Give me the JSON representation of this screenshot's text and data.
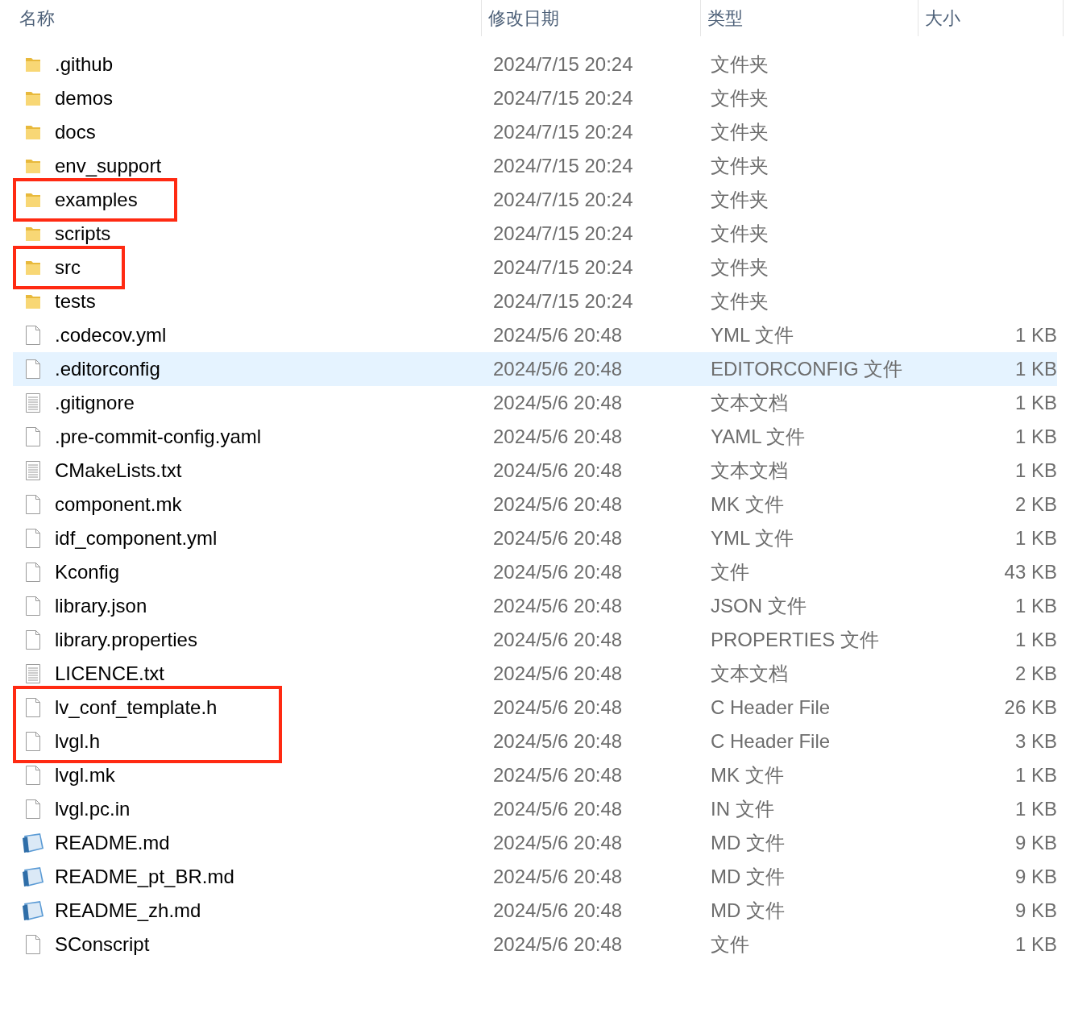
{
  "columns": [
    "名称",
    "修改日期",
    "类型",
    "大小"
  ],
  "rows": [
    {
      "kind": "folder",
      "name": ".github",
      "date": "2024/7/15 20:24",
      "type": "文件夹",
      "size": "",
      "selected": false,
      "annotated": false
    },
    {
      "kind": "folder",
      "name": "demos",
      "date": "2024/7/15 20:24",
      "type": "文件夹",
      "size": "",
      "selected": false,
      "annotated": false
    },
    {
      "kind": "folder",
      "name": "docs",
      "date": "2024/7/15 20:24",
      "type": "文件夹",
      "size": "",
      "selected": false,
      "annotated": false
    },
    {
      "kind": "folder",
      "name": "env_support",
      "date": "2024/7/15 20:24",
      "type": "文件夹",
      "size": "",
      "selected": false,
      "annotated": false
    },
    {
      "kind": "folder",
      "name": "examples",
      "date": "2024/7/15 20:24",
      "type": "文件夹",
      "size": "",
      "selected": false,
      "annotated": true
    },
    {
      "kind": "folder",
      "name": "scripts",
      "date": "2024/7/15 20:24",
      "type": "文件夹",
      "size": "",
      "selected": false,
      "annotated": false
    },
    {
      "kind": "folder",
      "name": "src",
      "date": "2024/7/15 20:24",
      "type": "文件夹",
      "size": "",
      "selected": false,
      "annotated": true
    },
    {
      "kind": "folder",
      "name": "tests",
      "date": "2024/7/15 20:24",
      "type": "文件夹",
      "size": "",
      "selected": false,
      "annotated": false
    },
    {
      "kind": "file",
      "name": ".codecov.yml",
      "date": "2024/5/6 20:48",
      "type": "YML 文件",
      "size": "1 KB",
      "selected": false,
      "annotated": false
    },
    {
      "kind": "file",
      "name": ".editorconfig",
      "date": "2024/5/6 20:48",
      "type": "EDITORCONFIG 文件",
      "size": "1 KB",
      "selected": true,
      "annotated": false
    },
    {
      "kind": "text",
      "name": ".gitignore",
      "date": "2024/5/6 20:48",
      "type": "文本文档",
      "size": "1 KB",
      "selected": false,
      "annotated": false
    },
    {
      "kind": "file",
      "name": ".pre-commit-config.yaml",
      "date": "2024/5/6 20:48",
      "type": "YAML 文件",
      "size": "1 KB",
      "selected": false,
      "annotated": false
    },
    {
      "kind": "text",
      "name": "CMakeLists.txt",
      "date": "2024/5/6 20:48",
      "type": "文本文档",
      "size": "1 KB",
      "selected": false,
      "annotated": false
    },
    {
      "kind": "file",
      "name": "component.mk",
      "date": "2024/5/6 20:48",
      "type": "MK 文件",
      "size": "2 KB",
      "selected": false,
      "annotated": false
    },
    {
      "kind": "file",
      "name": "idf_component.yml",
      "date": "2024/5/6 20:48",
      "type": "YML 文件",
      "size": "1 KB",
      "selected": false,
      "annotated": false
    },
    {
      "kind": "file",
      "name": "Kconfig",
      "date": "2024/5/6 20:48",
      "type": "文件",
      "size": "43 KB",
      "selected": false,
      "annotated": false
    },
    {
      "kind": "file",
      "name": "library.json",
      "date": "2024/5/6 20:48",
      "type": "JSON 文件",
      "size": "1 KB",
      "selected": false,
      "annotated": false
    },
    {
      "kind": "file",
      "name": "library.properties",
      "date": "2024/5/6 20:48",
      "type": "PROPERTIES 文件",
      "size": "1 KB",
      "selected": false,
      "annotated": false
    },
    {
      "kind": "text",
      "name": "LICENCE.txt",
      "date": "2024/5/6 20:48",
      "type": "文本文档",
      "size": "2 KB",
      "selected": false,
      "annotated": false
    },
    {
      "kind": "file",
      "name": "lv_conf_template.h",
      "date": "2024/5/6 20:48",
      "type": "C Header File",
      "size": "26 KB",
      "selected": false,
      "annotated": true
    },
    {
      "kind": "file",
      "name": "lvgl.h",
      "date": "2024/5/6 20:48",
      "type": "C Header File",
      "size": "3 KB",
      "selected": false,
      "annotated": true
    },
    {
      "kind": "file",
      "name": "lvgl.mk",
      "date": "2024/5/6 20:48",
      "type": "MK 文件",
      "size": "1 KB",
      "selected": false,
      "annotated": false
    },
    {
      "kind": "file",
      "name": "lvgl.pc.in",
      "date": "2024/5/6 20:48",
      "type": "IN 文件",
      "size": "1 KB",
      "selected": false,
      "annotated": false
    },
    {
      "kind": "md",
      "name": "README.md",
      "date": "2024/5/6 20:48",
      "type": "MD 文件",
      "size": "9 KB",
      "selected": false,
      "annotated": false
    },
    {
      "kind": "md",
      "name": "README_pt_BR.md",
      "date": "2024/5/6 20:48",
      "type": "MD 文件",
      "size": "9 KB",
      "selected": false,
      "annotated": false
    },
    {
      "kind": "md",
      "name": "README_zh.md",
      "date": "2024/5/6 20:48",
      "type": "MD 文件",
      "size": "9 KB",
      "selected": false,
      "annotated": false
    },
    {
      "kind": "file",
      "name": "SConscript",
      "date": "2024/5/6 20:48",
      "type": "文件",
      "size": "1 KB",
      "selected": false,
      "annotated": false
    }
  ]
}
